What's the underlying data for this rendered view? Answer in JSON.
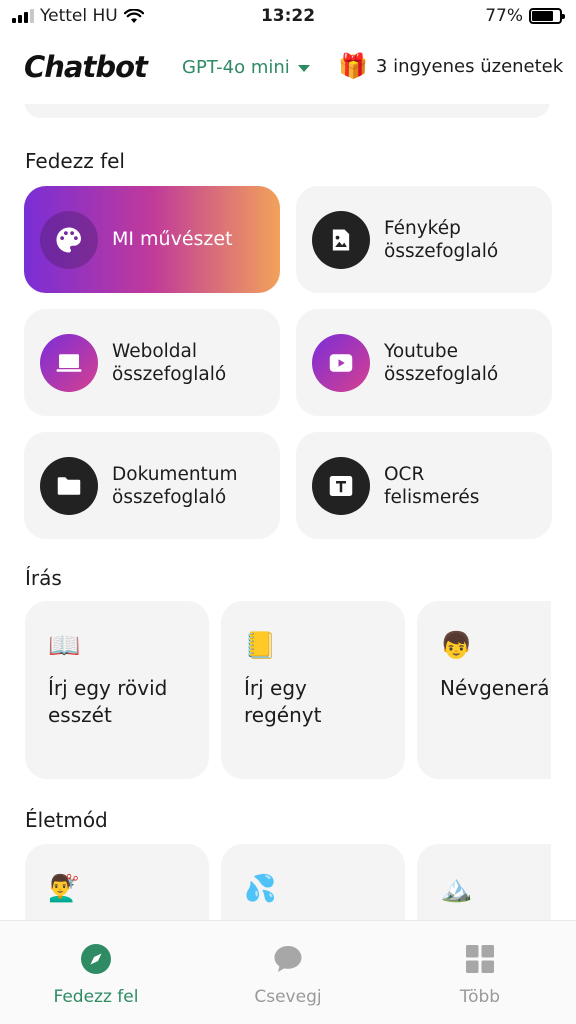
{
  "status_bar": {
    "carrier": "Yettel HU",
    "time": "13:22",
    "battery": "77%",
    "battery_level": 0.77
  },
  "header": {
    "logo": "Chatbot",
    "model": "GPT-4o mini",
    "free_messages": "3 ingyenes üzenetek"
  },
  "sections": {
    "explore": "Fedezz fel",
    "writing": "Írás",
    "lifestyle": "Életmód"
  },
  "explore_cards": [
    {
      "label": "MI művészet",
      "icon": "palette-icon"
    },
    {
      "label": "Fénykép összefoglaló",
      "line1": "Fénykép",
      "line2": "összefoglaló",
      "icon": "image-icon"
    },
    {
      "label": "Weboldal összefoglaló",
      "line1": "Weboldal",
      "line2": "összefoglaló",
      "icon": "laptop-icon"
    },
    {
      "label": "Youtube összefoglaló",
      "line1": "Youtube",
      "line2": "összefoglaló",
      "icon": "play-icon"
    },
    {
      "label": "Dokumentum összefoglaló",
      "line1": "Dokumentum",
      "line2": "összefoglaló",
      "icon": "folder-icon"
    },
    {
      "label": "OCR felismerés",
      "line1": "OCR",
      "line2": "felismerés",
      "icon": "text-icon"
    }
  ],
  "writing_cards": [
    {
      "emoji": "📖",
      "line1": "Írj egy rövid",
      "line2": "esszét"
    },
    {
      "emoji": "📒",
      "line1": "Írj egy",
      "line2": "regényt"
    },
    {
      "emoji": "👦",
      "line1": "Névgenerá",
      "line2": ""
    }
  ],
  "lifestyle_cards": [
    {
      "emoji": "💇‍♂️"
    },
    {
      "emoji": "💦"
    },
    {
      "emoji": "🏔️"
    }
  ],
  "bottom_nav": [
    {
      "label": "Fedezz fel",
      "icon": "compass-icon",
      "active": true
    },
    {
      "label": "Csevegj",
      "icon": "chat-bubble-icon",
      "active": false
    },
    {
      "label": "Több",
      "icon": "grid-icon",
      "active": false
    }
  ],
  "colors": {
    "accent": "#2e8b63",
    "card_bg": "#f4f4f4"
  }
}
